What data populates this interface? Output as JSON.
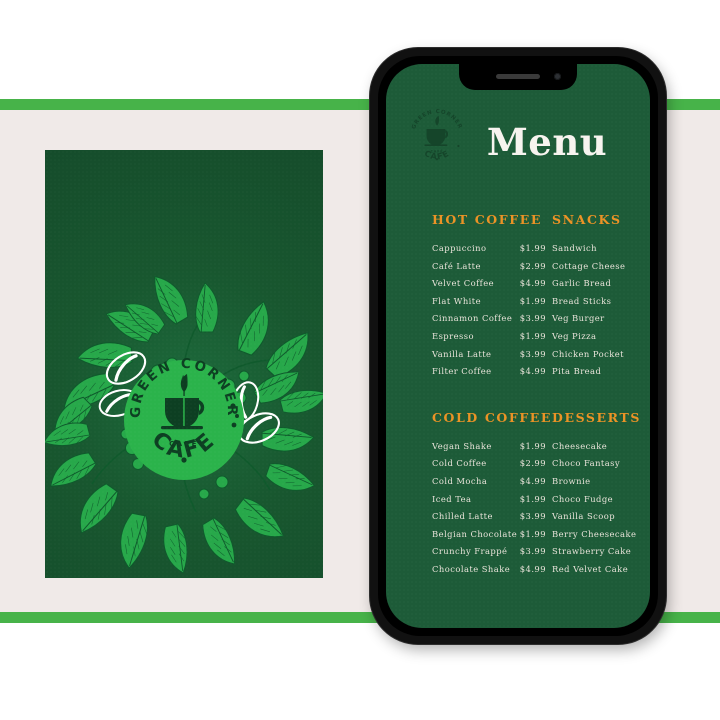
{
  "palette": {
    "band_green": "#47b349",
    "panel_beige": "#f0eae8",
    "poster_dark_green": "#18572f",
    "phone_screen_green": "#1d5b38",
    "heading_orange": "#eb9326",
    "menu_text": "#e9e4da",
    "logo_bright_green": "#2bb34b",
    "phone_body": "#111111"
  },
  "poster": {
    "logo": {
      "arc_top_text": "GREEN CORNER",
      "arc_bottom_text": "CAFE",
      "sub_text": "CAFÉ",
      "icon": "coffee-cup-with-leaf-icon"
    },
    "illustration": "coffee-plant-leaves-and-beans-line-art"
  },
  "phone": {
    "notch": {
      "speaker": "speaker-grille-icon",
      "camera": "front-camera-icon"
    },
    "logo": {
      "arc_top_text": "GREEN CORNER",
      "arc_bottom_text": "CAFE",
      "sub_text": "CAFÉ",
      "icon": "coffee-cup-with-leaf-icon"
    },
    "screen": {
      "title": "Menu",
      "sections": [
        {
          "id": "hot-coffee",
          "heading": "HOT COFFEE",
          "items": [
            {
              "name": "Cappuccino",
              "price": "$1.99"
            },
            {
              "name": "Café Latte",
              "price": "$2.99"
            },
            {
              "name": "Velvet Coffee",
              "price": "$4.99"
            },
            {
              "name": "Flat White",
              "price": "$1.99"
            },
            {
              "name": "Cinnamon Coffee",
              "price": "$3.99"
            },
            {
              "name": "Espresso",
              "price": "$1.99"
            },
            {
              "name": "Vanilla Latte",
              "price": "$3.99"
            },
            {
              "name": "Filter Coffee",
              "price": "$4.99"
            }
          ]
        },
        {
          "id": "snacks",
          "heading": "SNACKS",
          "items": [
            {
              "name": "Sandwich",
              "price": ""
            },
            {
              "name": "Cottage Cheese",
              "price": ""
            },
            {
              "name": "Garlic Bread",
              "price": ""
            },
            {
              "name": "Bread Sticks",
              "price": ""
            },
            {
              "name": "Veg Burger",
              "price": ""
            },
            {
              "name": "Veg Pizza",
              "price": ""
            },
            {
              "name": "Chicken Pocket",
              "price": ""
            },
            {
              "name": "Pita Bread",
              "price": ""
            }
          ]
        },
        {
          "id": "cold-coffee",
          "heading": "COLD COFFEE",
          "items": [
            {
              "name": "Vegan Shake",
              "price": "$1.99"
            },
            {
              "name": "Cold Coffee",
              "price": "$2.99"
            },
            {
              "name": "Cold Mocha",
              "price": "$4.99"
            },
            {
              "name": "Iced Tea",
              "price": "$1.99"
            },
            {
              "name": "Chilled Latte",
              "price": "$3.99"
            },
            {
              "name": "Belgian Chocolate",
              "price": "$1.99"
            },
            {
              "name": "Crunchy Frappé",
              "price": "$3.99"
            },
            {
              "name": "Chocolate Shake",
              "price": "$4.99"
            }
          ]
        },
        {
          "id": "desserts",
          "heading": "DESSERTS",
          "items": [
            {
              "name": "Cheesecake",
              "price": ""
            },
            {
              "name": "Choco Fantasy",
              "price": ""
            },
            {
              "name": "Brownie",
              "price": ""
            },
            {
              "name": "Choco Fudge",
              "price": ""
            },
            {
              "name": "Vanilla Scoop",
              "price": ""
            },
            {
              "name": "Berry Cheesecake",
              "price": ""
            },
            {
              "name": "Strawberry Cake",
              "price": ""
            },
            {
              "name": "Red Velvet Cake",
              "price": ""
            }
          ]
        }
      ]
    }
  }
}
